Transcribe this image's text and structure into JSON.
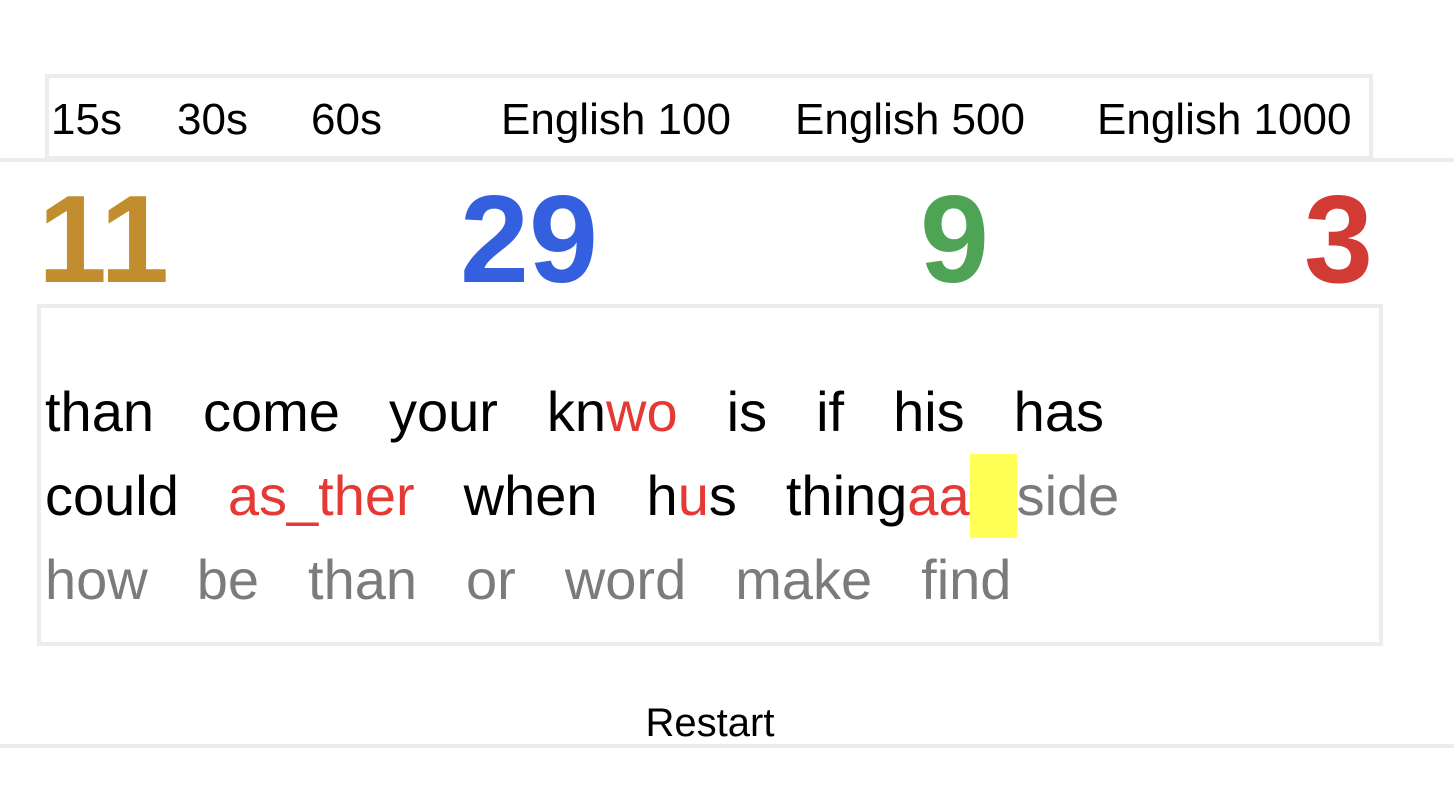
{
  "options": {
    "times": [
      "15s",
      "30s",
      "60s"
    ],
    "word_lists": [
      "English 100",
      "English 500",
      "English 1000"
    ]
  },
  "stats": {
    "timer": "11",
    "wpm": "29",
    "correct": "9",
    "incorrect": "3",
    "colors": {
      "timer": "#c18d2f",
      "wpm": "#3460e0",
      "correct": "#4ea454",
      "incorrect": "#d13b34"
    }
  },
  "typing": {
    "line1": [
      {
        "ok": "than"
      },
      {
        "ok": "come"
      },
      {
        "ok": "your"
      },
      {
        "ok": "kn",
        "bad": "wo"
      },
      {
        "ok": "is"
      },
      {
        "ok": "if"
      },
      {
        "ok": "his"
      },
      {
        "ok": "has"
      }
    ],
    "line2": [
      {
        "ok": "could"
      },
      {
        "bad": "as_ther"
      },
      {
        "ok": "when"
      },
      {
        "ok": "h",
        "bad": "u",
        "ok2": "s"
      },
      {
        "ok": "thing",
        "bad": "aa"
      },
      {
        "pending": "side"
      }
    ],
    "line3": [
      "how",
      "be",
      "than",
      "or",
      "word",
      "make",
      "find"
    ]
  },
  "restart_label": "Restart"
}
